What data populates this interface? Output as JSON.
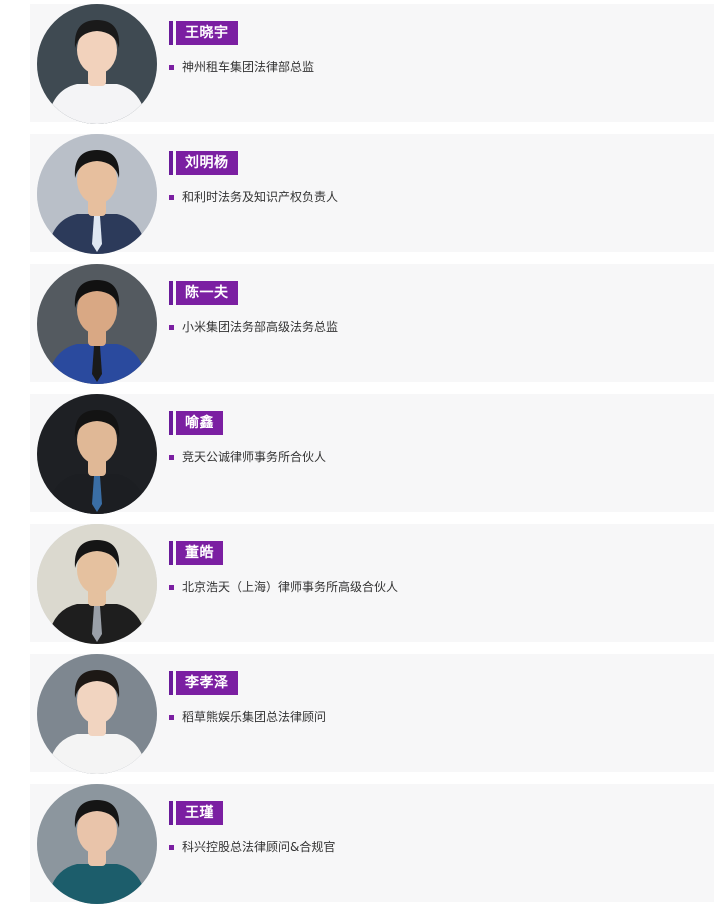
{
  "speakers": [
    {
      "name": "王晓宇",
      "title": "神州租车集团法律部总监",
      "colors": {
        "bg": "#3f4a52",
        "hair": "#1a1a1a",
        "skin": "#f2d2bc",
        "shirt": "#f4f4f6",
        "tie": ""
      }
    },
    {
      "name": "刘明杨",
      "title": "和利时法务及知识产权负责人",
      "colors": {
        "bg": "#b9bfc8",
        "hair": "#141414",
        "skin": "#e7bf9e",
        "shirt": "#2c3a5a",
        "tie": "#dfe7f2"
      }
    },
    {
      "name": "陈一夫",
      "title": "小米集团法务部高级法务总监",
      "colors": {
        "bg": "#545a60",
        "hair": "#111111",
        "skin": "#d9a884",
        "shirt": "#2a4a9e",
        "tie": "#1a1a1a"
      }
    },
    {
      "name": "喻鑫",
      "title": "竞天公诚律师事务所合伙人",
      "colors": {
        "bg": "#1e2024",
        "hair": "#131313",
        "skin": "#e0b896",
        "shirt": "#1c1e22",
        "tie": "#3a6ea5"
      }
    },
    {
      "name": "董皓",
      "title": "北京浩天（上海）律师事务所高级合伙人",
      "colors": {
        "bg": "#dbd9cf",
        "hair": "#151515",
        "skin": "#e5c19f",
        "shirt": "#1e1e1e",
        "tie": "#9aa0a8"
      }
    },
    {
      "name": "李孝泽",
      "title": "稻草熊娱乐集团总法律顾问",
      "colors": {
        "bg": "#7e8790",
        "hair": "#1d1815",
        "skin": "#f1d4c0",
        "shirt": "#f4f4f4",
        "tie": ""
      }
    },
    {
      "name": "王瑾",
      "title": "科兴控股总法律顾问&合规官",
      "colors": {
        "bg": "#8c969e",
        "hair": "#151515",
        "skin": "#e9c4aa",
        "shirt": "#1c5d6b",
        "tie": ""
      }
    }
  ]
}
